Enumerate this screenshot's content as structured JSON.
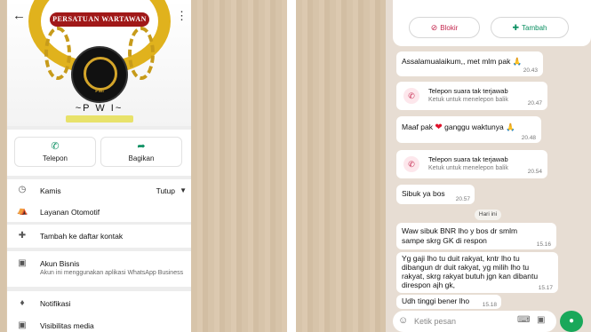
{
  "left_profile": {
    "logo_text": "PERSATUAN WARTAWAN",
    "avatar_text": "PWI",
    "name": "~P W I~",
    "actions": [
      {
        "icon": "phone-icon",
        "label": "Telepon"
      },
      {
        "icon": "share-icon",
        "label": "Bagikan"
      }
    ],
    "hours": {
      "day": "Kamis",
      "status": "Tutup"
    },
    "category": "Layanan Otomotif",
    "add_contact": "Tambah ke daftar kontak",
    "business": {
      "title": "Akun Bisnis",
      "subtitle": "Akun ini menggunakan aplikasi WhatsApp Business"
    },
    "notifications": "Notifikasi",
    "media_visibility": "Visibilitas media"
  },
  "right_chat": {
    "top_buttons": {
      "block": "Blokir",
      "add": "Tambah"
    },
    "messages": [
      {
        "id": "m1",
        "type": "text",
        "text": "Assalamualaikum,, met mlm pak",
        "emoji": "🙏",
        "time": "20.43"
      },
      {
        "id": "m2",
        "type": "call",
        "title": "Telepon suara tak terjawab",
        "subtitle": "Ketuk untuk menelepon balik",
        "time": "20.47"
      },
      {
        "id": "m3",
        "type": "text",
        "text_before": "Maaf pak",
        "text_after": "ganggu waktunya",
        "emoji": "🙏",
        "time": "20.48"
      },
      {
        "id": "m4",
        "type": "call",
        "title": "Telepon suara tak terjawab",
        "subtitle": "Ketuk untuk menelepon balik",
        "time": "20.54"
      },
      {
        "id": "m5",
        "type": "text",
        "text": "Sibuk ya bos",
        "time": "20.57"
      },
      {
        "id": "m6",
        "type": "text",
        "lines": [
          "Waw sibuk BNR lho y bos dr smlm",
          "sampe skrg GK di respon"
        ],
        "time": "15.16"
      },
      {
        "id": "m7",
        "type": "text",
        "lines": [
          "Yg gaji lho tu duit rakyat, kntr lho tu",
          "dibangun dr duit rakyat, yg milih lho tu",
          "rakyat, skrg rakyat butuh jgn kan dibantu",
          "direspon ajh gk,"
        ],
        "time": "15.17"
      },
      {
        "id": "m8",
        "type": "text",
        "text": "Udh tinggi bener lho",
        "time": "15.18"
      }
    ],
    "day_separator": "Hari ini",
    "input_placeholder": "Ketik pesan",
    "colors": {
      "accent": "#19a85a",
      "chat_bg": "#e7ddd3",
      "missed_call": "#c4274e"
    }
  }
}
